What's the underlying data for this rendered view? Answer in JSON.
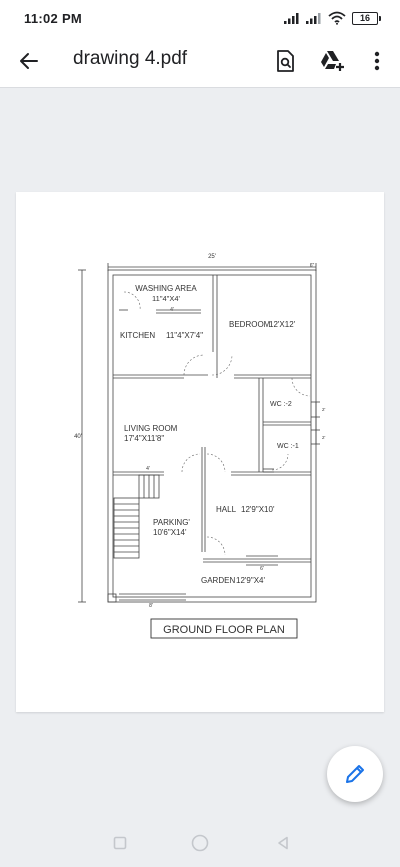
{
  "status_bar": {
    "time": "11:02 PM",
    "battery": "16"
  },
  "app_bar": {
    "title": "drawing 4.pdf",
    "icons": [
      "back-arrow-icon",
      "find-in-page-icon",
      "drive-add-icon",
      "more-vert-icon"
    ]
  },
  "floor_plan": {
    "overall_width": "25'",
    "overall_depth": "40'",
    "wall_thickness_mark": "6\"",
    "rooms": {
      "washing_area": {
        "name": "WASHING AREA",
        "size": "11\"4\"X4'"
      },
      "kitchen": {
        "name": "KITCHEN",
        "size": "11\"4\"X7'4\""
      },
      "bedroom": {
        "name": "BEDROOM",
        "size": "12'X12'"
      },
      "wc2": {
        "name": "WC :-2"
      },
      "wc1": {
        "name": "WC :-1"
      },
      "living_room": {
        "name": "LIVING ROOM",
        "size": "17'4\"X11'8\""
      },
      "hall": {
        "name": "HALL",
        "size": "12'9\"X10'"
      },
      "parking": {
        "name": "PARKING'",
        "size": "10'6\"X14'"
      },
      "garden": {
        "name": "GARDEN",
        "size": "12'9\"X4'"
      }
    },
    "opening_marks": {
      "washing_window": "4'",
      "wc_window_1": "2'",
      "wc_window_2": "2'",
      "stair_window": "4'",
      "garden_window": "6'",
      "gate": "8'"
    },
    "plan_title": "GROUND FLOOR PLAN"
  },
  "fab": {
    "icon": "edit-pencil-icon"
  },
  "nav_bar": {
    "icons": [
      "recents-square-icon",
      "home-circle-icon",
      "back-triangle-icon"
    ]
  },
  "colors": {
    "background": "#eceef1",
    "accent": "#1a73e8",
    "plan_line": "#333333"
  }
}
